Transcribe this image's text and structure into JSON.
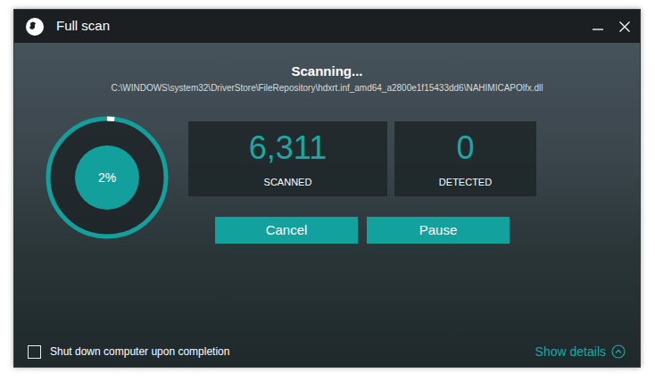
{
  "window": {
    "title": "Full scan"
  },
  "status": {
    "heading": "Scanning...",
    "current_file": "C:\\WINDOWS\\system32\\DriverStore\\FileRepository\\hdxrt.inf_amd64_a2800e1f15433dd6\\NAHIMICAPOlfx.dll"
  },
  "progress": {
    "label": "2%",
    "level": 0.02
  },
  "stats": [
    {
      "value": "6,311",
      "label": "SCANNED"
    },
    {
      "value": "0",
      "label": "DETECTED"
    }
  ],
  "buttons": [
    "Cancel",
    "Pause"
  ],
  "shutdown_option": {
    "label": "Shut down computer upon completion",
    "checked": false
  },
  "details_toggle": {
    "label": "Show details",
    "expanded": false
  }
}
